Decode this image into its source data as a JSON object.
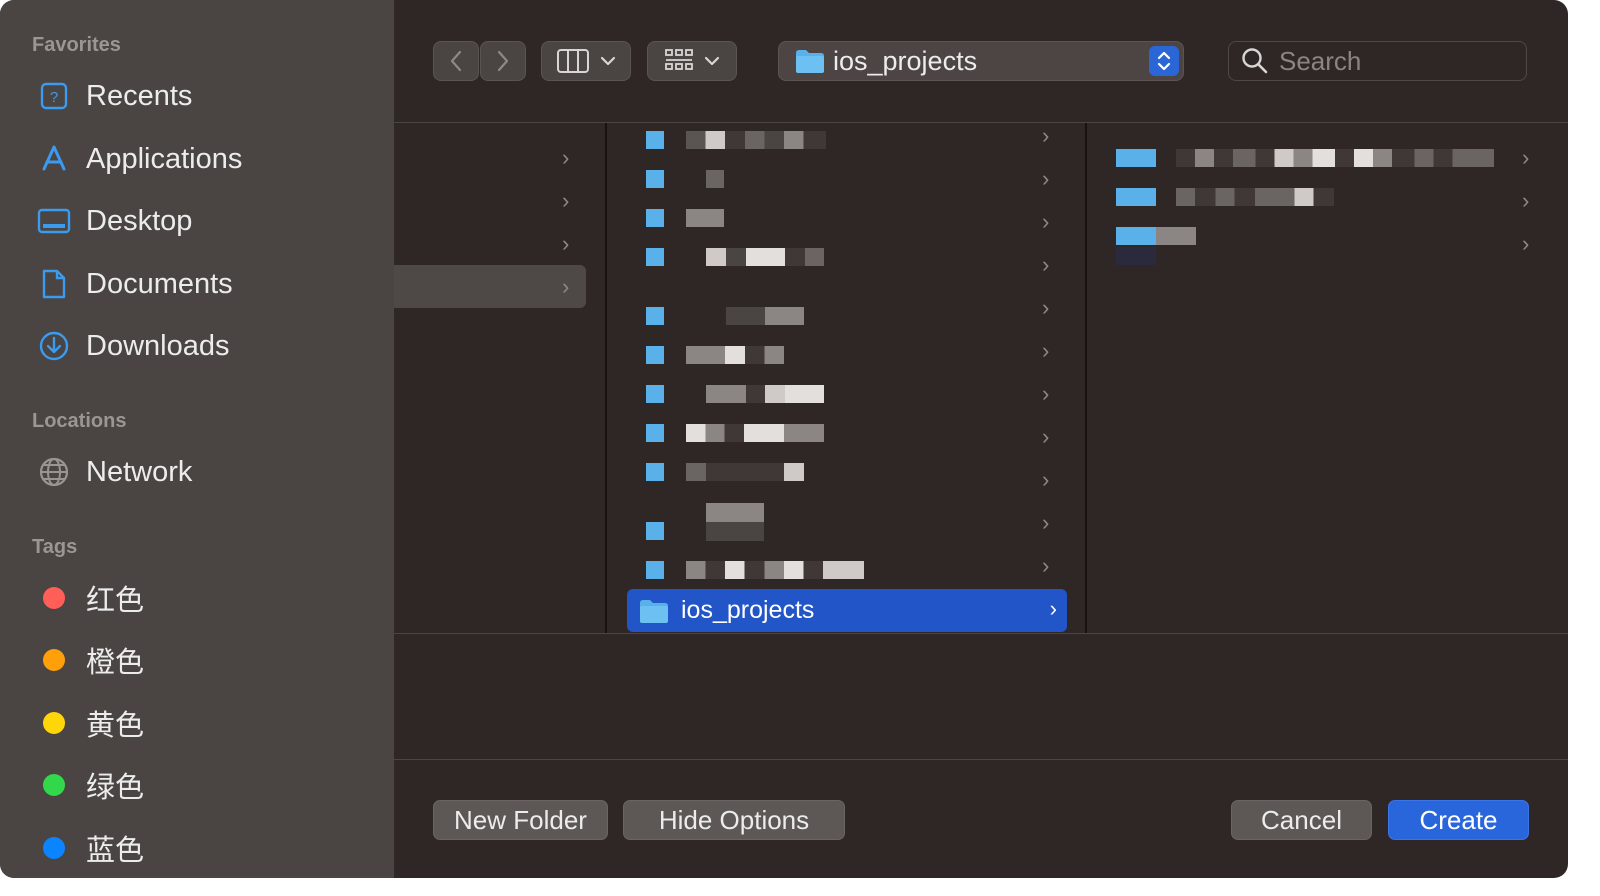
{
  "sidebar": {
    "favorites_label": "Favorites",
    "favorites": [
      {
        "label": "Recents",
        "icon": "recents-icon"
      },
      {
        "label": "Applications",
        "icon": "applications-icon"
      },
      {
        "label": "Desktop",
        "icon": "desktop-icon"
      },
      {
        "label": "Documents",
        "icon": "documents-icon"
      },
      {
        "label": "Downloads",
        "icon": "downloads-icon"
      }
    ],
    "locations_label": "Locations",
    "locations": [
      {
        "label": "Network",
        "icon": "network-icon"
      }
    ],
    "tags_label": "Tags",
    "tags": [
      {
        "label": "红色",
        "color": "#ff5f57"
      },
      {
        "label": "橙色",
        "color": "#ff9f0a"
      },
      {
        "label": "黄色",
        "color": "#ffd60a"
      },
      {
        "label": "绿色",
        "color": "#32d74b"
      },
      {
        "label": "蓝色",
        "color": "#0a84ff"
      }
    ]
  },
  "toolbar": {
    "current_folder": "ios_projects",
    "search_placeholder": "Search"
  },
  "browser": {
    "selected_item": "ios_projects"
  },
  "footer": {
    "new_folder": "New Folder",
    "hide_options": "Hide Options",
    "cancel": "Cancel",
    "create": "Create"
  },
  "colors": {
    "accent": "#2a66db",
    "folder": "#5ab0e8"
  }
}
